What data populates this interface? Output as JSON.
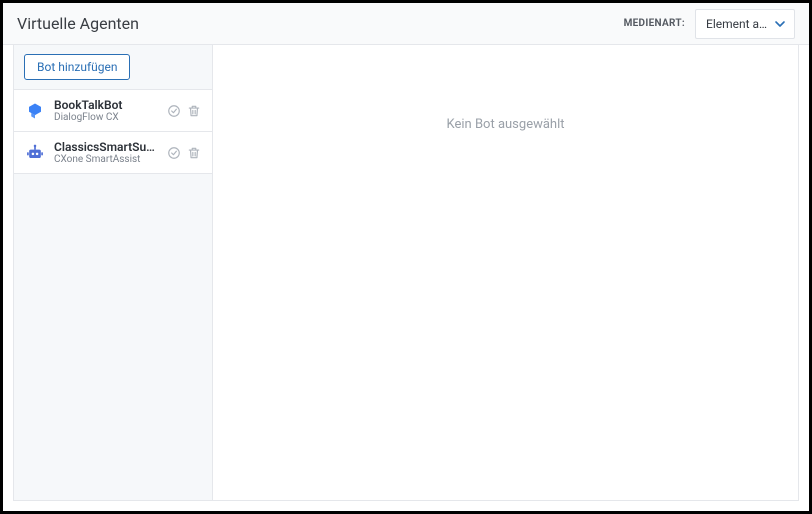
{
  "header": {
    "title": "Virtuelle Agenten",
    "media_label": "MEDIENART:",
    "select_value": "Element a..."
  },
  "sidebar": {
    "add_button": "Bot hinzufügen",
    "bots": [
      {
        "name": "BookTalkBot",
        "subtitle": "DialogFlow CX"
      },
      {
        "name": "ClassicsSmartSupport",
        "subtitle": "CXone SmartAssist"
      }
    ]
  },
  "main": {
    "empty_text": "Kein Bot ausgewählt"
  }
}
